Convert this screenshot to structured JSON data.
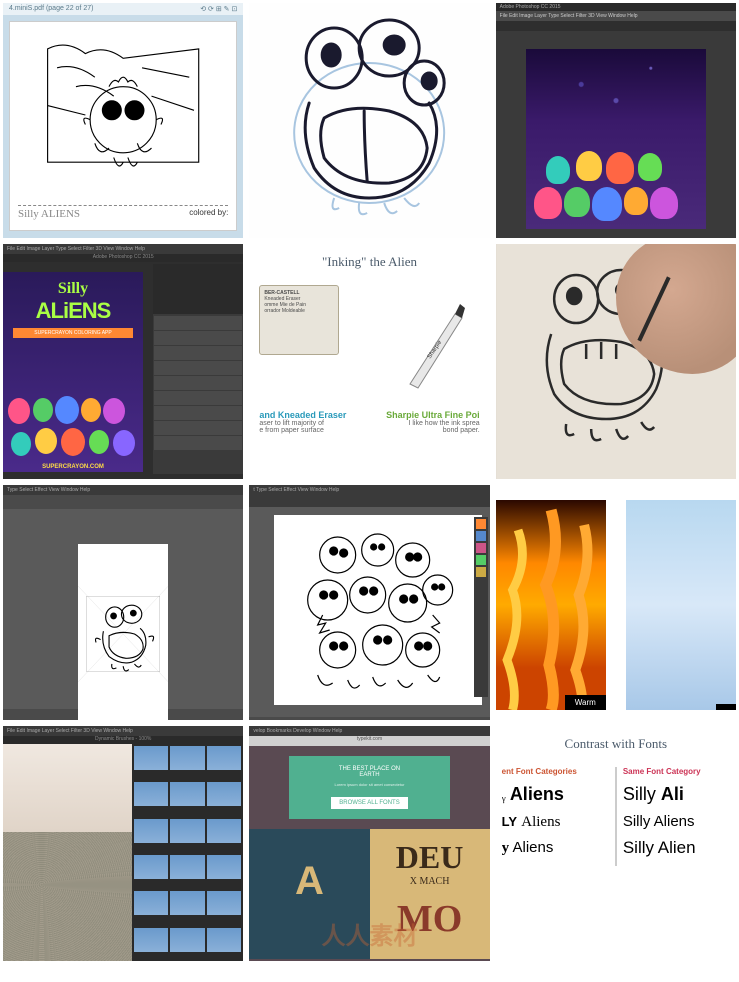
{
  "tiles": {
    "t1": {
      "filename": "4.miniS.pdf (page 22 of 27)",
      "icons": "⟲ ⟳ ⊞ ✎ ⊡",
      "colored_by": "colored by:",
      "logo": "Silly ALIENS"
    },
    "t3": {
      "app_title": "Adobe Photoshop CC 2015",
      "menu": "File  Edit  Image  Layer  Type  Select  Filter  3D  View  Window  Help"
    },
    "t4": {
      "menu": "File  Edit  Image  Layer  Type  Select  Filter  3D  View  Window  Help",
      "app_title": "Adobe Photoshop CC 2015",
      "logo_top": "Silly",
      "logo_main": "ALiENS",
      "tagline": "SUPERCRAYON COLORING APP",
      "url": "SUPERCRAYON.COM"
    },
    "t5": {
      "title": "\"Inking\" the Alien",
      "eraser_brand": "BER-CASTELL",
      "eraser_line1": "Kneaded Eraser",
      "eraser_line2": "omme Mie de Pain",
      "eraser_line3": "orrador Moldeable",
      "pen_brand": "Sharpie",
      "left_cap": "and Kneaded Eraser",
      "left_desc1": "aser to lift majority of",
      "left_desc2": "e from paper surface",
      "right_cap": "Sharpie Ultra Fine Poi",
      "right_desc1": "I like how the ink sprea",
      "right_desc2": "bond paper."
    },
    "t7": {
      "menu": "Type  Select  Effect  View  Window  Help"
    },
    "t8": {
      "menu": "t  Type  Select  Effect  View  Window  Help"
    },
    "t9": {
      "warm": "Warm",
      "cold": ""
    },
    "t10": {
      "menu": "File  Edit  Image  Layer  Select  Filter  3D  View  Window  Help",
      "tab": "Dynamic Brushes - 100%"
    },
    "t11": {
      "menu": "velop  Bookmarks  Develop  Window  Help",
      "url": "typekit.com",
      "card_title": "THE BEST PLACE ON",
      "card_sub": "EARTH",
      "btn": "BROWSE ALL FONTS",
      "f1": "A",
      "f2a": "DEU",
      "f2b": "X MACH",
      "f3": "MO"
    },
    "t12": {
      "title": "Contrast with Fonts",
      "left_cat": "ent Font Categories",
      "right_cat": "Same Font Category",
      "l1a": "ᵧ",
      "l1b": "Aliens",
      "l2a": "LY",
      "l2b": "Aliens",
      "l3a": "y",
      "l3b": "Aliens",
      "r1a": "Silly",
      "r1b": "Ali",
      "r2": "Silly Aliens",
      "r3": "Silly Alien"
    }
  },
  "watermark": "人人素材"
}
